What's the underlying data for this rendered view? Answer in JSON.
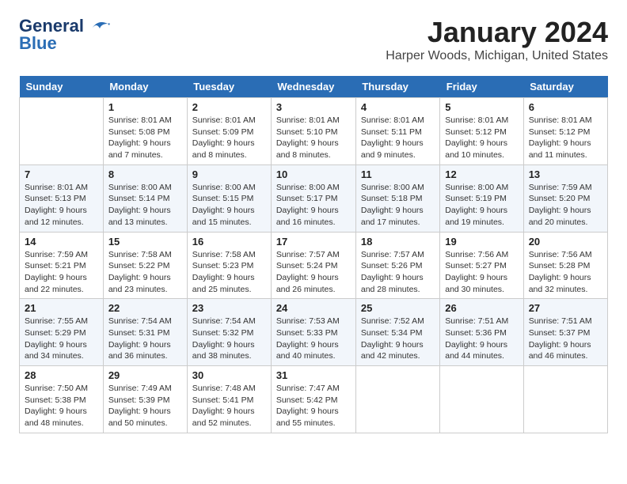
{
  "header": {
    "logo_line1": "General",
    "logo_line2": "Blue",
    "month": "January 2024",
    "location": "Harper Woods, Michigan, United States"
  },
  "weekdays": [
    "Sunday",
    "Monday",
    "Tuesday",
    "Wednesday",
    "Thursday",
    "Friday",
    "Saturday"
  ],
  "weeks": [
    [
      {
        "day": "",
        "info": ""
      },
      {
        "day": "1",
        "info": "Sunrise: 8:01 AM\nSunset: 5:08 PM\nDaylight: 9 hours\nand 7 minutes."
      },
      {
        "day": "2",
        "info": "Sunrise: 8:01 AM\nSunset: 5:09 PM\nDaylight: 9 hours\nand 8 minutes."
      },
      {
        "day": "3",
        "info": "Sunrise: 8:01 AM\nSunset: 5:10 PM\nDaylight: 9 hours\nand 8 minutes."
      },
      {
        "day": "4",
        "info": "Sunrise: 8:01 AM\nSunset: 5:11 PM\nDaylight: 9 hours\nand 9 minutes."
      },
      {
        "day": "5",
        "info": "Sunrise: 8:01 AM\nSunset: 5:12 PM\nDaylight: 9 hours\nand 10 minutes."
      },
      {
        "day": "6",
        "info": "Sunrise: 8:01 AM\nSunset: 5:12 PM\nDaylight: 9 hours\nand 11 minutes."
      }
    ],
    [
      {
        "day": "7",
        "info": "Sunrise: 8:01 AM\nSunset: 5:13 PM\nDaylight: 9 hours\nand 12 minutes."
      },
      {
        "day": "8",
        "info": "Sunrise: 8:00 AM\nSunset: 5:14 PM\nDaylight: 9 hours\nand 13 minutes."
      },
      {
        "day": "9",
        "info": "Sunrise: 8:00 AM\nSunset: 5:15 PM\nDaylight: 9 hours\nand 15 minutes."
      },
      {
        "day": "10",
        "info": "Sunrise: 8:00 AM\nSunset: 5:17 PM\nDaylight: 9 hours\nand 16 minutes."
      },
      {
        "day": "11",
        "info": "Sunrise: 8:00 AM\nSunset: 5:18 PM\nDaylight: 9 hours\nand 17 minutes."
      },
      {
        "day": "12",
        "info": "Sunrise: 8:00 AM\nSunset: 5:19 PM\nDaylight: 9 hours\nand 19 minutes."
      },
      {
        "day": "13",
        "info": "Sunrise: 7:59 AM\nSunset: 5:20 PM\nDaylight: 9 hours\nand 20 minutes."
      }
    ],
    [
      {
        "day": "14",
        "info": "Sunrise: 7:59 AM\nSunset: 5:21 PM\nDaylight: 9 hours\nand 22 minutes."
      },
      {
        "day": "15",
        "info": "Sunrise: 7:58 AM\nSunset: 5:22 PM\nDaylight: 9 hours\nand 23 minutes."
      },
      {
        "day": "16",
        "info": "Sunrise: 7:58 AM\nSunset: 5:23 PM\nDaylight: 9 hours\nand 25 minutes."
      },
      {
        "day": "17",
        "info": "Sunrise: 7:57 AM\nSunset: 5:24 PM\nDaylight: 9 hours\nand 26 minutes."
      },
      {
        "day": "18",
        "info": "Sunrise: 7:57 AM\nSunset: 5:26 PM\nDaylight: 9 hours\nand 28 minutes."
      },
      {
        "day": "19",
        "info": "Sunrise: 7:56 AM\nSunset: 5:27 PM\nDaylight: 9 hours\nand 30 minutes."
      },
      {
        "day": "20",
        "info": "Sunrise: 7:56 AM\nSunset: 5:28 PM\nDaylight: 9 hours\nand 32 minutes."
      }
    ],
    [
      {
        "day": "21",
        "info": "Sunrise: 7:55 AM\nSunset: 5:29 PM\nDaylight: 9 hours\nand 34 minutes."
      },
      {
        "day": "22",
        "info": "Sunrise: 7:54 AM\nSunset: 5:31 PM\nDaylight: 9 hours\nand 36 minutes."
      },
      {
        "day": "23",
        "info": "Sunrise: 7:54 AM\nSunset: 5:32 PM\nDaylight: 9 hours\nand 38 minutes."
      },
      {
        "day": "24",
        "info": "Sunrise: 7:53 AM\nSunset: 5:33 PM\nDaylight: 9 hours\nand 40 minutes."
      },
      {
        "day": "25",
        "info": "Sunrise: 7:52 AM\nSunset: 5:34 PM\nDaylight: 9 hours\nand 42 minutes."
      },
      {
        "day": "26",
        "info": "Sunrise: 7:51 AM\nSunset: 5:36 PM\nDaylight: 9 hours\nand 44 minutes."
      },
      {
        "day": "27",
        "info": "Sunrise: 7:51 AM\nSunset: 5:37 PM\nDaylight: 9 hours\nand 46 minutes."
      }
    ],
    [
      {
        "day": "28",
        "info": "Sunrise: 7:50 AM\nSunset: 5:38 PM\nDaylight: 9 hours\nand 48 minutes."
      },
      {
        "day": "29",
        "info": "Sunrise: 7:49 AM\nSunset: 5:39 PM\nDaylight: 9 hours\nand 50 minutes."
      },
      {
        "day": "30",
        "info": "Sunrise: 7:48 AM\nSunset: 5:41 PM\nDaylight: 9 hours\nand 52 minutes."
      },
      {
        "day": "31",
        "info": "Sunrise: 7:47 AM\nSunset: 5:42 PM\nDaylight: 9 hours\nand 55 minutes."
      },
      {
        "day": "",
        "info": ""
      },
      {
        "day": "",
        "info": ""
      },
      {
        "day": "",
        "info": ""
      }
    ]
  ]
}
